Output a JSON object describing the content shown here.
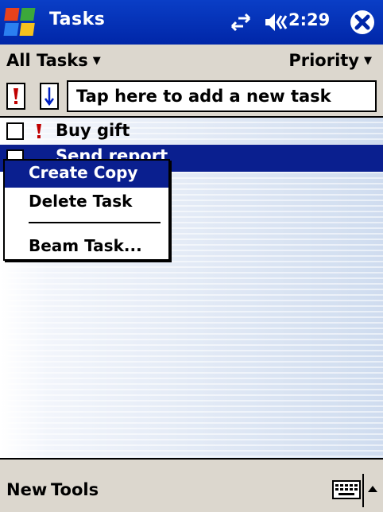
{
  "titlebar": {
    "app_title": "Tasks",
    "clock": "2:29",
    "icons": [
      "windows-start-icon",
      "connectivity-icon",
      "volume-icon",
      "close-icon"
    ]
  },
  "filterbar": {
    "category": "All Tasks",
    "sort": "Priority"
  },
  "entrybar": {
    "placeholder": "Tap here to add a new task"
  },
  "tasks": [
    {
      "title": "Buy gift",
      "priority": "high",
      "completed": false,
      "selected": false
    },
    {
      "title": "Send report",
      "priority": "normal",
      "completed": false,
      "selected": true
    }
  ],
  "context_menu": {
    "items": [
      "Create Copy",
      "Delete Task",
      "Beam Task..."
    ],
    "highlighted": "Create Copy"
  },
  "menubar": {
    "new_label": "New",
    "tools_label": "Tools"
  },
  "colors": {
    "titlebar": "#0026a8",
    "selection": "#0a1f8f",
    "bars": "#dcd7ce",
    "priority_high": "#c00000",
    "priority_low": "#0020c0"
  }
}
